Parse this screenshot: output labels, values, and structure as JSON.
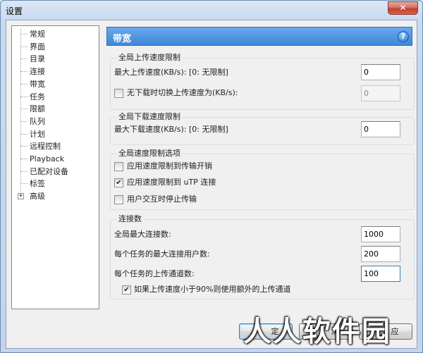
{
  "window": {
    "title": "设置",
    "close_label": "✕"
  },
  "tree": {
    "items": [
      {
        "label": "常规"
      },
      {
        "label": "界面"
      },
      {
        "label": "目录"
      },
      {
        "label": "连接"
      },
      {
        "label": "带宽"
      },
      {
        "label": "任务"
      },
      {
        "label": "限额"
      },
      {
        "label": "队列"
      },
      {
        "label": "计划"
      },
      {
        "label": "远程控制"
      },
      {
        "label": "Playback"
      },
      {
        "label": "已配对设备"
      },
      {
        "label": "标签"
      },
      {
        "label": "高级",
        "expander": "+"
      }
    ],
    "selected": "带宽"
  },
  "header": {
    "title": "带宽",
    "help": "?"
  },
  "upload_group": {
    "title": "全局上传速度限制",
    "max_label": "最大上传速度(KB/s): [0: 无限制]",
    "max_value": "0",
    "alt_label": "无下载时切换上传速度为(KB/s):",
    "alt_checked": false,
    "alt_value": "0"
  },
  "download_group": {
    "title": "全局下载速度限制",
    "max_label": "最大下载速度(KB/s): [0: 无限制]",
    "max_value": "0"
  },
  "options_group": {
    "title": "全局速度限制选项",
    "overhead_label": "应用速度限制到传输开销",
    "overhead_checked": false,
    "utp_label": "应用速度限制到 uTP 连接",
    "utp_checked": true,
    "idle_label": "用户交互时停止传输",
    "idle_checked": false
  },
  "connections_group": {
    "title": "连接数",
    "global_max_label": "全局最大连接数:",
    "global_max_value": "1000",
    "per_task_peers_label": "每个任务的最大连接用户数:",
    "per_task_peers_value": "200",
    "upload_slots_label": "每个任务的上传通道数:",
    "upload_slots_value": "100",
    "extra_slots_label": "如果上传速度小于90%则使用额外的上传通道",
    "extra_slots_checked": true
  },
  "buttons": {
    "ok_partial": "定",
    "cancel_partial": "消",
    "apply_partial": "应"
  },
  "watermark": "人人软件园"
}
